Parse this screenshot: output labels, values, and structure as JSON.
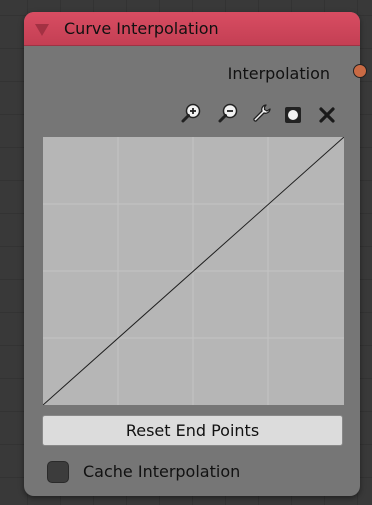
{
  "node": {
    "title": "Curve Interpolation",
    "header_color": "#d04a5e",
    "output": {
      "label": "Interpolation",
      "socket_color": "#c96a44"
    }
  },
  "toolbar": {
    "icons": [
      "zoom-in-icon",
      "zoom-out-icon",
      "wrench-icon",
      "clip-icon",
      "close-icon"
    ]
  },
  "curve": {
    "type": "linear",
    "points": [
      [
        0,
        0
      ],
      [
        1,
        1
      ]
    ]
  },
  "reset_button": {
    "label": "Reset End Points"
  },
  "cache_checkbox": {
    "label": "Cache Interpolation",
    "checked": false
  }
}
